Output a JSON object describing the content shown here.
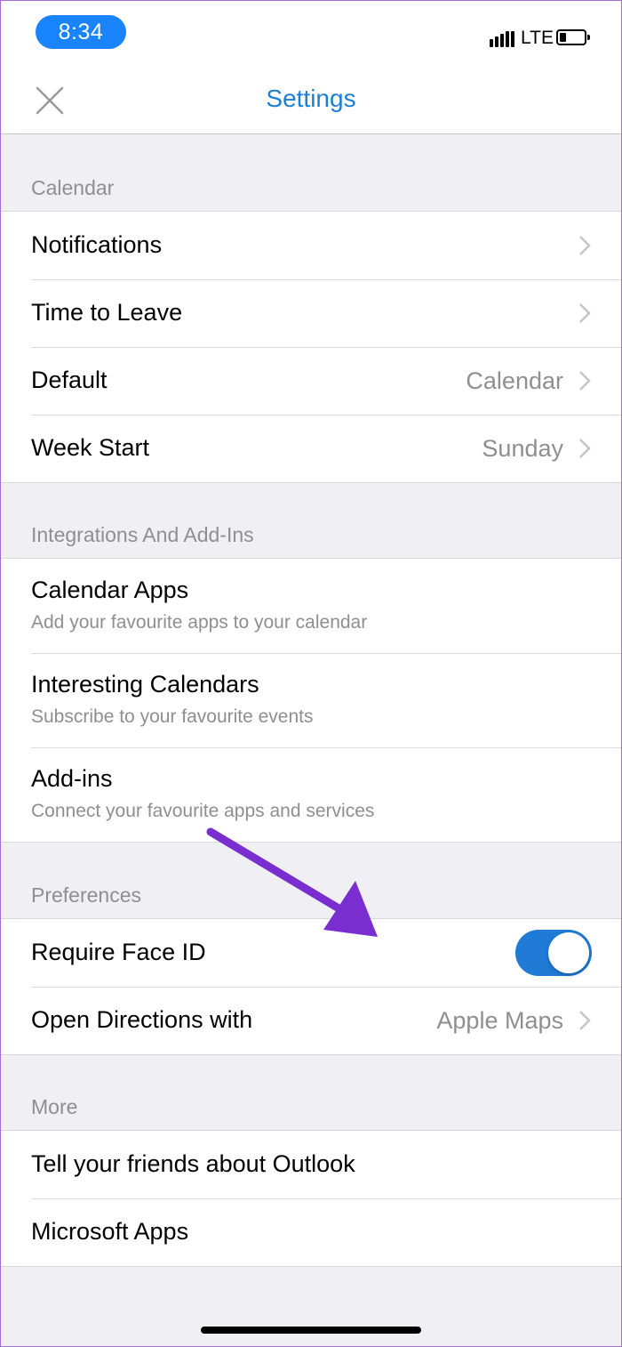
{
  "status_bar": {
    "time": "8:34",
    "network": "LTE"
  },
  "nav": {
    "title": "Settings",
    "close_icon": "close-icon"
  },
  "colors": {
    "accent": "#1b7fd6",
    "toggle_on": "#1f7bd6",
    "annotation_arrow": "#7a2ed0",
    "time_pill": "#1a84ff"
  },
  "sections": {
    "calendar": {
      "header": "Calendar",
      "rows": [
        {
          "label": "Notifications"
        },
        {
          "label": "Time to Leave"
        },
        {
          "label": "Default",
          "value": "Calendar"
        },
        {
          "label": "Week Start",
          "value": "Sunday"
        }
      ]
    },
    "integrations": {
      "header": "Integrations And Add-Ins",
      "rows": [
        {
          "label": "Calendar Apps",
          "subtitle": "Add your favourite apps to your calendar"
        },
        {
          "label": "Interesting Calendars",
          "subtitle": "Subscribe to your favourite events"
        },
        {
          "label": "Add-ins",
          "subtitle": "Connect your favourite apps and services"
        }
      ]
    },
    "preferences": {
      "header": "Preferences",
      "rows": [
        {
          "label": "Require Face ID",
          "toggle_on": true
        },
        {
          "label": "Open Directions with",
          "value": "Apple Maps"
        }
      ]
    },
    "more": {
      "header": "More",
      "rows": [
        {
          "label": "Tell your friends about Outlook"
        },
        {
          "label": "Microsoft Apps"
        }
      ]
    }
  }
}
